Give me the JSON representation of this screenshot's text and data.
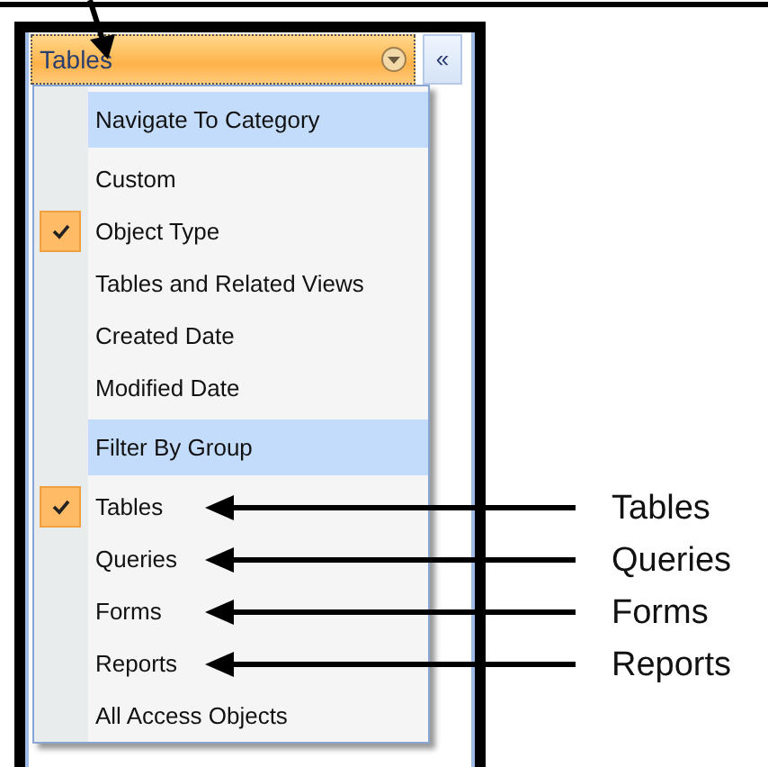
{
  "pane": {
    "title": "Tables",
    "collapse_label": "«"
  },
  "menu": [
    {
      "kind": "header",
      "label": "Navigate To Category"
    },
    {
      "kind": "item",
      "label": "Custom",
      "checked": false
    },
    {
      "kind": "item",
      "label": "Object Type",
      "checked": true
    },
    {
      "kind": "item",
      "label": "Tables and Related Views",
      "checked": false
    },
    {
      "kind": "item",
      "label": "Created Date",
      "checked": false
    },
    {
      "kind": "item",
      "label": "Modified Date",
      "checked": false
    },
    {
      "kind": "header",
      "label": "Filter By Group"
    },
    {
      "kind": "item",
      "label": "Tables",
      "checked": true,
      "callout": "Tables"
    },
    {
      "kind": "item",
      "label": "Queries",
      "checked": false,
      "callout": "Queries"
    },
    {
      "kind": "item",
      "label": "Forms",
      "checked": false,
      "callout": "Forms"
    },
    {
      "kind": "item",
      "label": "Reports",
      "checked": false,
      "callout": "Reports"
    },
    {
      "kind": "item",
      "label": "All Access Objects",
      "checked": false
    }
  ]
}
